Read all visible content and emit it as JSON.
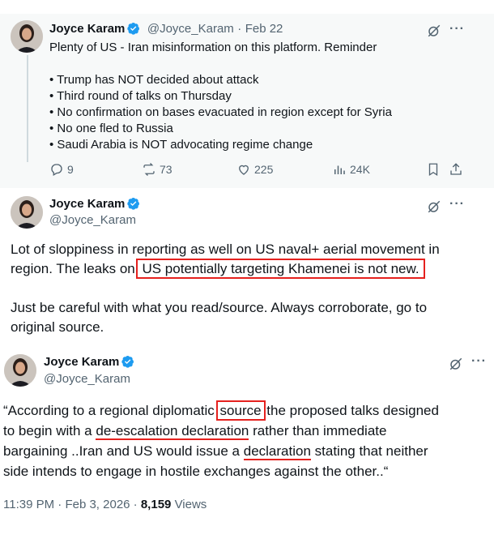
{
  "tweet1": {
    "name": "Joyce Karam",
    "handle": "@Joyce_Karam",
    "sep": "·",
    "date": "Feb 22",
    "text": "Plenty of US - Iran misinformation on this platform. Reminder",
    "bullets": [
      "• Trump has NOT decided about attack",
      "• Third round of talks on Thursday",
      "• No confirmation on bases evacuated in region except for Syria",
      "• No one fled to Russia",
      "• Saudi Arabia is NOT advocating regime change"
    ],
    "replies": "9",
    "reposts": "73",
    "likes": "225",
    "views": "24K"
  },
  "tweet2": {
    "name": "Joyce Karam",
    "handle": "@Joyce_Karam",
    "line1a": "Lot of sloppiness in ",
    "line1b": "reporting as well on US naval+ aerial movement in",
    "line2a": "region. The leaks on",
    "line2b": "US potentially targeting Khamenei is not new.",
    "para2": "Just be careful with what you read/source. Always corroborate, go to original source."
  },
  "tweet3": {
    "name": "Joyce Karam",
    "handle": "@Joyce_Karam",
    "t1": "“According to a regional diplomatic ",
    "t1hl": "source",
    "t1b": " the proposed talks designed",
    "t2a": "to begin with a ",
    "t2ul": "de-escalation declaration",
    "t2b": " rather than immediate",
    "t3a": "bargaining ..Iran and US would issue a ",
    "t3ul": "declaration",
    "t3b": " stating that neither",
    "t4": "side intends to engage in hostile exchanges against the other..“",
    "time": "11:39 PM",
    "date": "Feb 3, 2026",
    "sep1": "·",
    "sep2": "·",
    "views_count": "8,159",
    "views_label": "Views"
  },
  "icons": {
    "verified_color": "#1d9bf0",
    "grok": "grok-icon",
    "more": "more-icon"
  }
}
